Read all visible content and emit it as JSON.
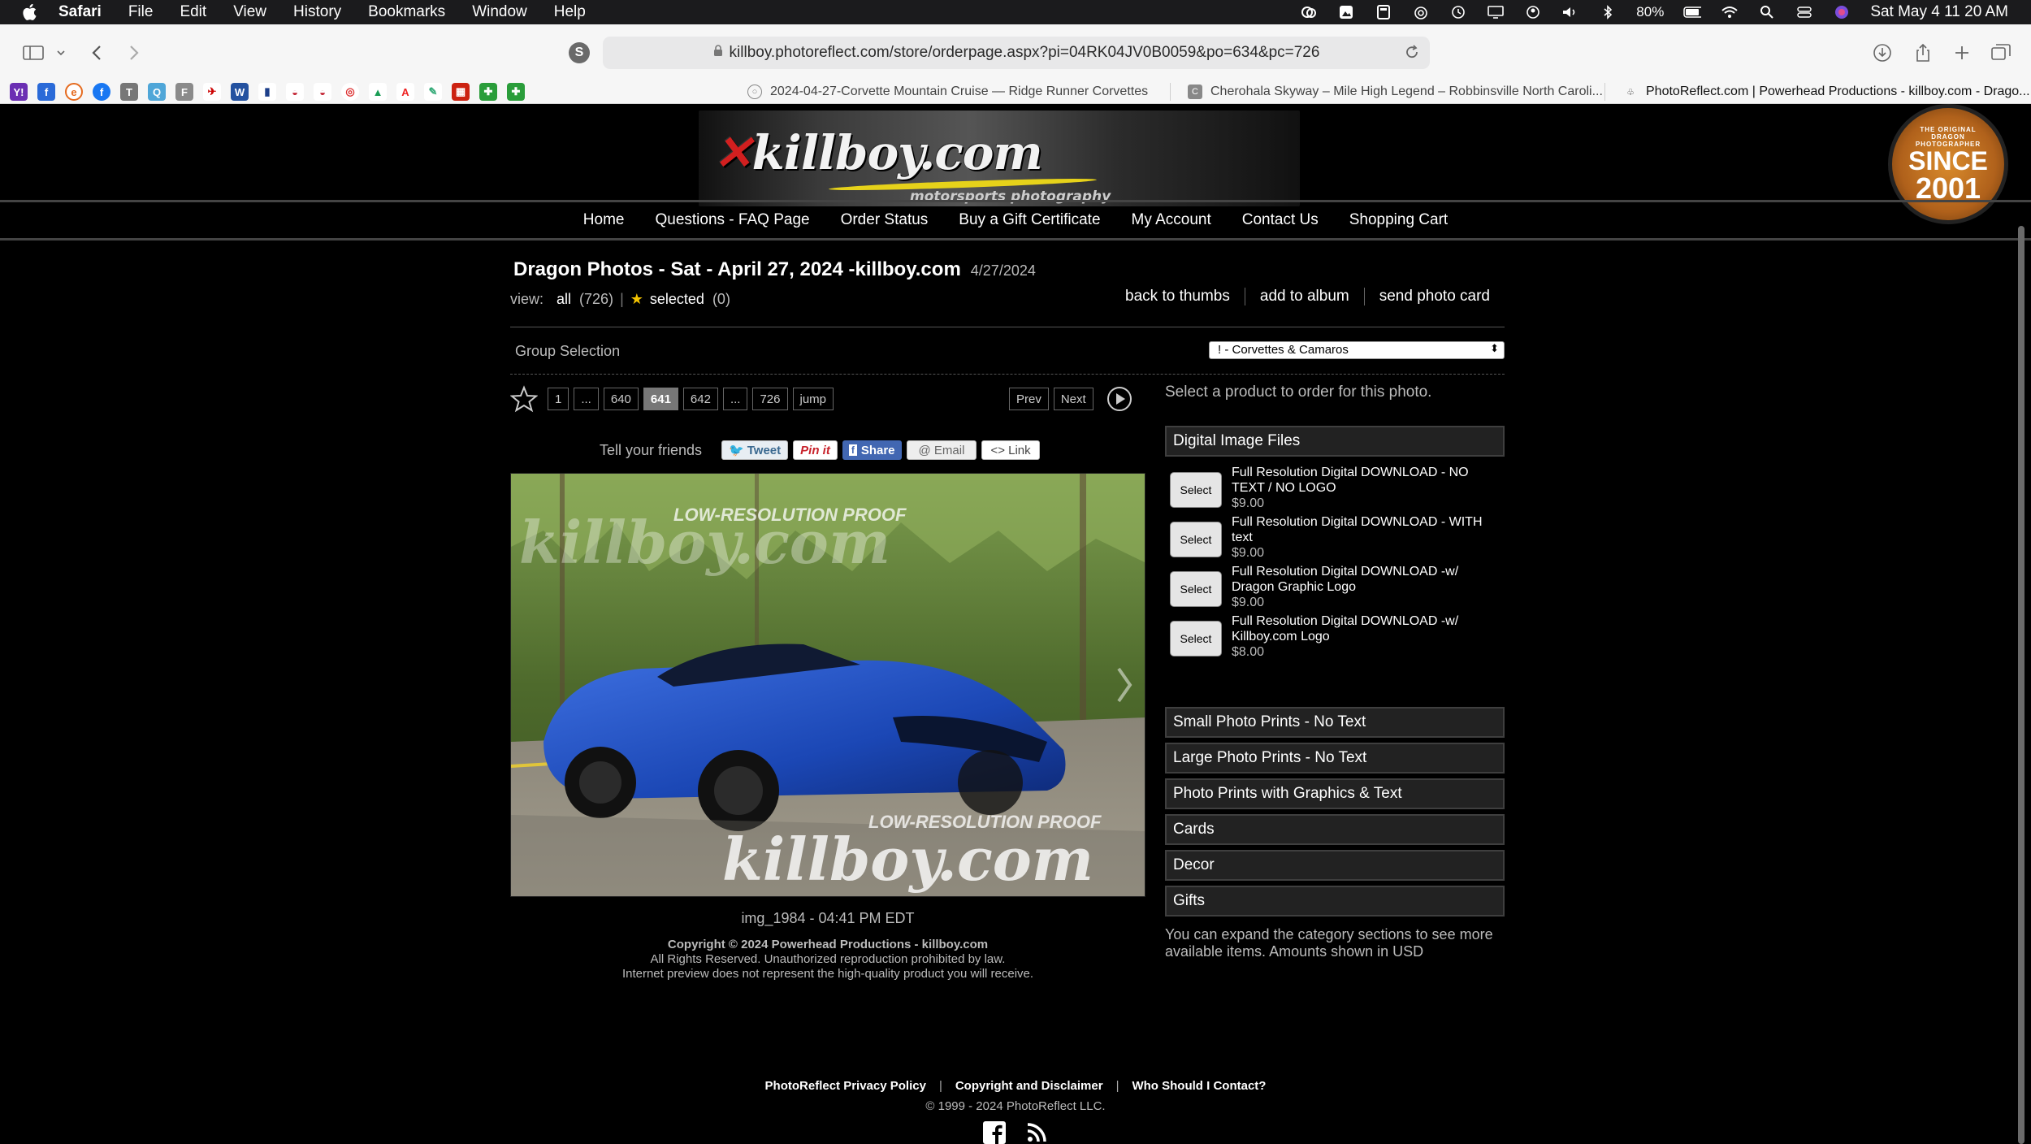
{
  "menubar": {
    "app": "Safari",
    "items": [
      "File",
      "Edit",
      "View",
      "History",
      "Bookmarks",
      "Window",
      "Help"
    ],
    "battery": "80%",
    "datetime": "Sat May 4  11 20 AM"
  },
  "browser": {
    "url": "killboy.photoreflect.com/store/orderpage.aspx?pi=04RK04JV0B0059&po=634&pc=726",
    "tabs": [
      {
        "title": "2024-04-27-Corvette Mountain Cruise — Ridge Runner Corvettes"
      },
      {
        "title": "Cherohala Skyway – Mile High Legend – Robbinsville North Caroli..."
      },
      {
        "title": "PhotoReflect.com | Powerhead Productions - killboy.com - Drago..."
      }
    ]
  },
  "site": {
    "logo": "killboy.com",
    "logo_sub": "motorsports photography",
    "seal": {
      "top": "THE ORIGINAL DRAGON PHOTOGRAPHER",
      "since": "SINCE",
      "year": "2001"
    },
    "nav": [
      "Home",
      "Questions - FAQ Page",
      "Order Status",
      "Buy a Gift Certificate",
      "My Account",
      "Contact Us",
      "Shopping Cart"
    ]
  },
  "gallery": {
    "title": "Dragon Photos - Sat - April 27, 2024 -killboy.com",
    "date": "4/27/2024",
    "view_label": "view:",
    "view_all": "all",
    "view_all_count": "(726)",
    "view_selected": "selected",
    "view_selected_count": "(0)",
    "actions": {
      "back": "back to thumbs",
      "album": "add to album",
      "card": "send photo card"
    },
    "group_label": "Group Selection",
    "group_value": "! - Corvettes & Camaros",
    "pages": {
      "first": "1",
      "ellipsis": "...",
      "prev_num": "640",
      "current": "641",
      "next_num": "642",
      "last": "726",
      "jump": "jump",
      "prev": "Prev",
      "next": "Next"
    },
    "tell_friends": "Tell your friends",
    "share": {
      "tweet": "Tweet",
      "pin": "Pin it",
      "share": "Share",
      "email": "@ Email",
      "link": "<> Link"
    },
    "photo": {
      "watermark_top": "LOW-RESOLUTION PROOF",
      "watermark_logo": "killboy.com",
      "watermark_bottom": "LOW-RESOLUTION PROOF"
    },
    "caption": "img_1984 - 04:41 PM EDT",
    "copyright": {
      "line1": "Copyright © 2024 Powerhead Productions - killboy.com",
      "line2": "All Rights Reserved. Unauthorized reproduction prohibited by law.",
      "line3": "Internet preview does not represent the high-quality product you will receive."
    }
  },
  "products": {
    "hint": "Select a product to order for this photo.",
    "open_category": "Digital Image Files",
    "select_label": "Select",
    "items": [
      {
        "name": "Full Resolution Digital DOWNLOAD - NO TEXT / NO LOGO",
        "price": "$9.00"
      },
      {
        "name": "Full Resolution Digital DOWNLOAD - WITH text",
        "price": "$9.00"
      },
      {
        "name": "Full Resolution Digital DOWNLOAD -w/ Dragon Graphic Logo",
        "price": "$9.00"
      },
      {
        "name": "Full Resolution Digital DOWNLOAD -w/ Killboy.com Logo",
        "price": "$8.00"
      }
    ],
    "categories": [
      "Small Photo Prints - No Text",
      "Large Photo Prints - No Text",
      "Photo Prints with Graphics & Text",
      "Cards",
      "Decor",
      "Gifts"
    ],
    "expand_hint": "You can expand the category sections to see more available items. Amounts shown in USD"
  },
  "footer": {
    "links": [
      "PhotoReflect Privacy Policy",
      "Copyright and Disclaimer",
      "Who Should I Contact?"
    ],
    "copy": "© 1999 - 2024 PhotoReflect LLC."
  }
}
